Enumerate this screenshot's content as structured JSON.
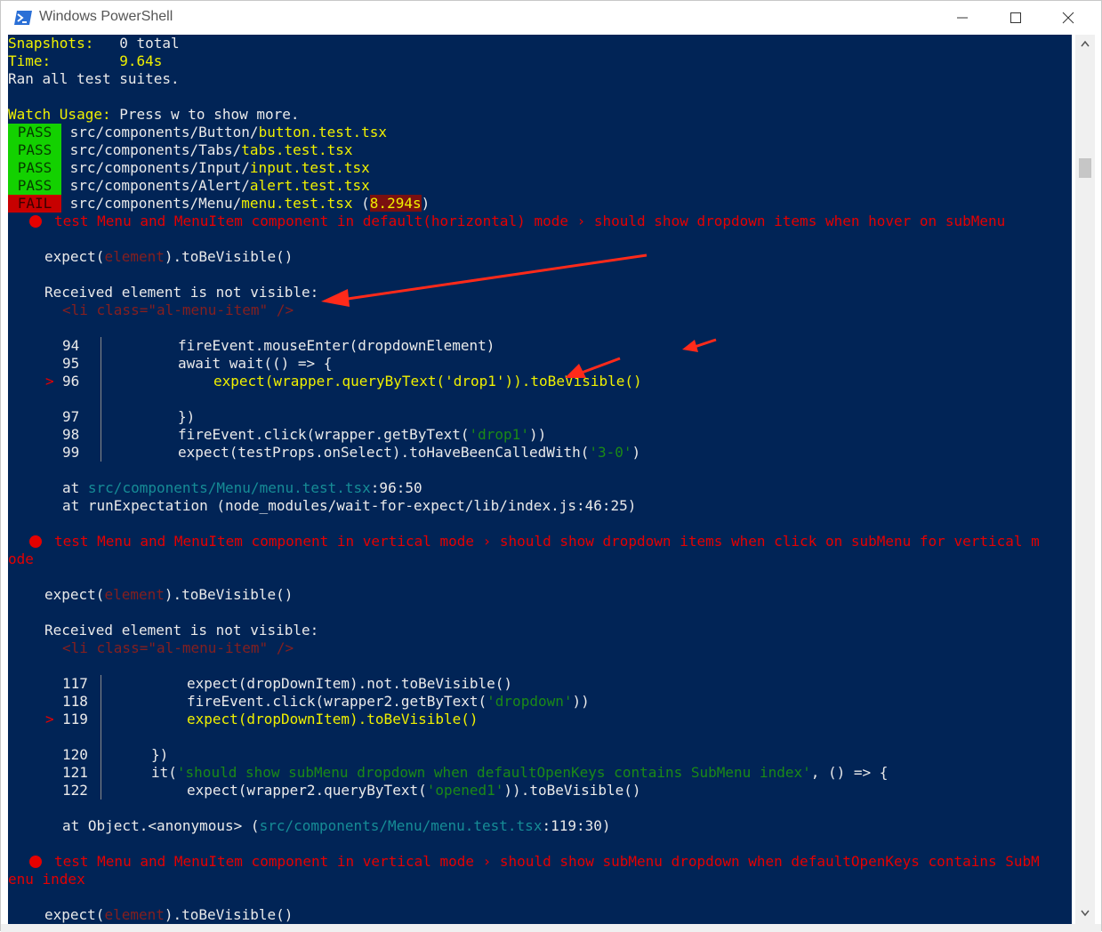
{
  "window": {
    "title": "Windows PowerShell"
  },
  "summary": {
    "snapshots_label": "Snapshots:",
    "snapshots_value": "0 total",
    "time_label": "Time:",
    "time_value": "9.64s",
    "ran": "Ran all test suites."
  },
  "watch": {
    "label": "Watch Usage:",
    "text": " Press w to show more."
  },
  "results": [
    {
      "status": "PASS",
      "dir": " src/components/Button/",
      "file": "button.test.tsx"
    },
    {
      "status": "PASS",
      "dir": " src/components/Tabs/",
      "file": "tabs.test.tsx"
    },
    {
      "status": "PASS",
      "dir": " src/components/Input/",
      "file": "input.test.tsx"
    },
    {
      "status": "PASS",
      "dir": " src/components/Alert/",
      "file": "alert.test.tsx"
    }
  ],
  "fail_result": {
    "status": "FAIL",
    "dir": " src/components/Menu/",
    "file": "menu.test.tsx",
    "open": " (",
    "time": "8.294s",
    "close": ")"
  },
  "failure1": {
    "title": "test Menu and MenuItem component in default(horizontal) mode › should show dropdown items when hover on subMenu",
    "expect_a": "expect(",
    "expect_b": "element",
    "expect_c": ").toBeVisible()",
    "received": "Received element is not visible:",
    "element": "<li class=\"al-menu-item\" />",
    "code": [
      {
        "num": "94",
        "text": "fireEvent.mouseEnter(dropdownElement)"
      },
      {
        "num": "95",
        "text": "await wait(() => {"
      },
      {
        "num": "96",
        "text": "expect(wrapper.queryByText('drop1')).toBeVisible()"
      },
      {
        "num": "97",
        "text": "})"
      },
      {
        "num": "98",
        "text_a": "fireEvent.click(wrapper.getByText(",
        "text_b": "'drop1'",
        "text_c": "))"
      },
      {
        "num": "99",
        "text_a": "expect(testProps.onSelect).toHaveBeenCalledWith(",
        "text_b": "'3-0'",
        "text_c": ")"
      }
    ],
    "at1_a": "at ",
    "at1_b": "src/components/Menu/menu.test.tsx",
    "at1_c": ":96:50",
    "at2": "at runExpectation (node_modules/wait-for-expect/lib/index.js:46:25)"
  },
  "failure2": {
    "title": "test Menu and MenuItem component in vertical mode › should show dropdown items when click on subMenu for vertical m",
    "title_wrap": "ode",
    "expect_a": "expect(",
    "expect_b": "element",
    "expect_c": ").toBeVisible()",
    "received": "Received element is not visible:",
    "element": "<li class=\"al-menu-item\" />",
    "code": [
      {
        "num": "117",
        "text": "expect(dropDownItem).not.toBeVisible()"
      },
      {
        "num": "118",
        "text_a": "fireEvent.click(wrapper2.getByText(",
        "text_b": "'dropdown'",
        "text_c": "))"
      },
      {
        "num": "119",
        "text": "expect(dropDownItem).toBeVisible()"
      },
      {
        "num": "120",
        "text": "})"
      },
      {
        "num": "121",
        "text_a": "it(",
        "text_b": "'should show subMenu dropdown when defaultOpenKeys contains SubMenu index'",
        "text_c": ", () => {"
      },
      {
        "num": "122",
        "text_a": "expect(wrapper2.queryByText(",
        "text_b": "'opened1'",
        "text_c": ")).toBeVisible()"
      }
    ],
    "at1_a": "at Object.<anonymous> (",
    "at1_b": "src/components/Menu/menu.test.tsx",
    "at1_c": ":119:30)"
  },
  "failure3": {
    "title": "test Menu and MenuItem component in vertical mode › should show subMenu dropdown when defaultOpenKeys contains SubM",
    "title_wrap": "enu index",
    "expect_a": "expect(",
    "expect_b": "element",
    "expect_c": ").toBeVisible()"
  },
  "colors": {
    "background": "#012456",
    "yellow": "#f0f000",
    "red": "#e50000",
    "pass_bg": "#13d100",
    "fail_bg": "#c70000",
    "annotation": "#ff2a1a"
  },
  "icons": [
    "powershell-icon",
    "minimize-icon",
    "maximize-icon",
    "close-icon",
    "scroll-up-icon",
    "scroll-down-icon",
    "error-dot-icon",
    "red-arrow-annotation"
  ]
}
